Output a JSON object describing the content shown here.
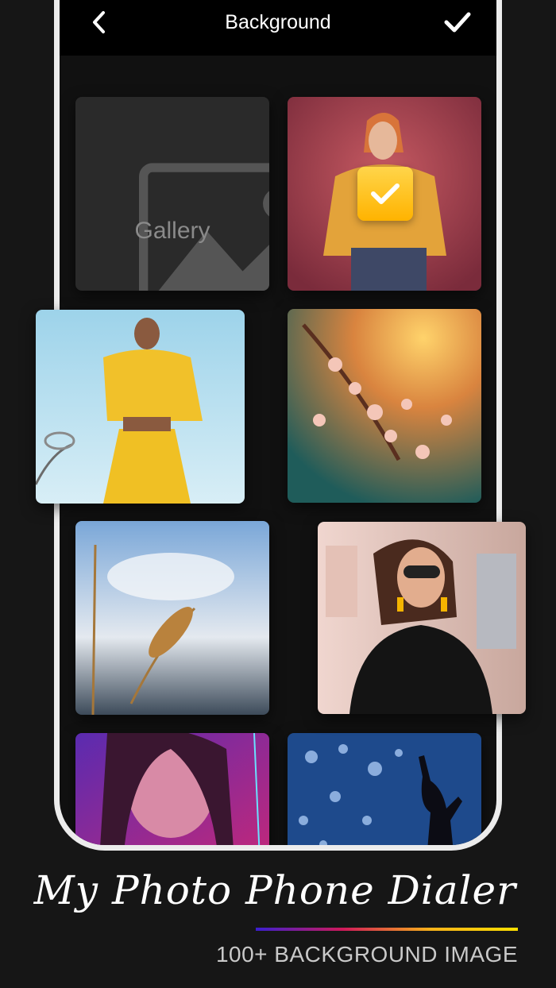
{
  "header": {
    "title": "Background"
  },
  "gallery": {
    "label": "Gallery"
  },
  "icons": {
    "back": "chevron-left-icon",
    "confirm": "checkmark-icon",
    "gallery": "image-icon",
    "selected": "check-badge-icon"
  },
  "backgrounds": [
    "woman-orange-top-red-smoke",
    "woman-yellow-hoodie-basketball-hoop",
    "cherry-blossom-sunset",
    "wheat-stalk-sky",
    "woman-sunglasses-black-dress",
    "woman-neon-pink-light",
    "silhouette-blue-bokeh"
  ],
  "selected_background": "woman-orange-top-red-smoke",
  "branding": {
    "app_name": "My Photo Phone Dialer",
    "tagline": "100+ BACKGROUND IMAGE"
  },
  "colors": {
    "accent_badge": "#ffc107",
    "gradient": [
      "#3a1fd0",
      "#d01a5a",
      "#f7b21a",
      "#ffe000"
    ]
  }
}
